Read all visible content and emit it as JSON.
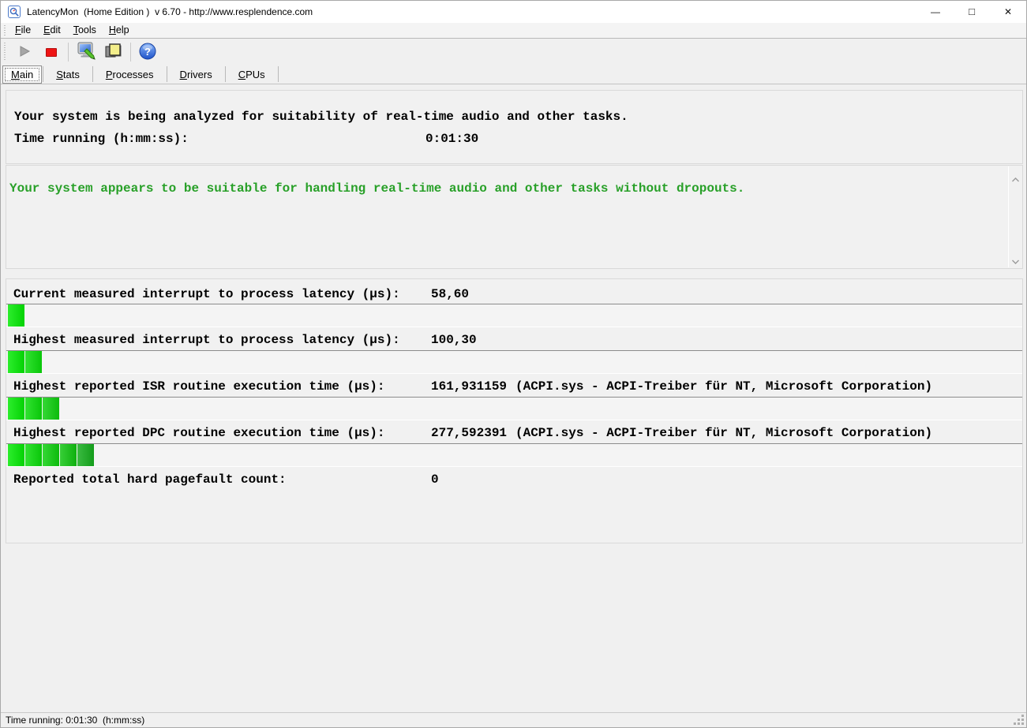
{
  "window": {
    "title": "LatencyMon  (Home Edition )  v 6.70 - http://www.resplendence.com",
    "controls": {
      "minimize": "—",
      "maximize": "□",
      "close": "✕"
    }
  },
  "menu": {
    "items": [
      {
        "label": "File"
      },
      {
        "label": "Edit"
      },
      {
        "label": "Tools"
      },
      {
        "label": "Help"
      }
    ]
  },
  "toolbar": {
    "buttons": [
      {
        "name": "start",
        "icon": "play-icon",
        "enabled": false
      },
      {
        "name": "stop",
        "icon": "stop-icon",
        "enabled": true
      },
      {
        "name": "options",
        "icon": "monitor-tool-icon",
        "enabled": true
      },
      {
        "name": "copy-report",
        "icon": "copy-icon",
        "enabled": true
      },
      {
        "name": "help",
        "icon": "help-icon",
        "enabled": true
      }
    ]
  },
  "tabs": {
    "active": "Main",
    "items": [
      {
        "label": "Main"
      },
      {
        "label": "Stats"
      },
      {
        "label": "Processes"
      },
      {
        "label": "Drivers"
      },
      {
        "label": "CPUs"
      }
    ]
  },
  "analysis": {
    "line1": "Your system is being analyzed for suitability of real-time audio and other tasks.",
    "time_label": "Time running (h:mm:ss):",
    "time_value": "0:01:30"
  },
  "verdict": {
    "message": "Your system appears to be suitable for handling real-time audio and other tasks without dropouts.",
    "color": "#28a028"
  },
  "measurements": {
    "segment_colors": [
      "#04ea04",
      "#0add0a",
      "#0ed00e",
      "#10c510",
      "#15ae1d"
    ],
    "rows": [
      {
        "label": "Current measured interrupt to process latency (µs):",
        "value": "58,60",
        "extra": "",
        "segments": 1
      },
      {
        "label": "Highest measured interrupt to process latency (µs):",
        "value": "100,30",
        "extra": "",
        "segments": 2
      },
      {
        "label": "Highest reported ISR routine execution time (µs):",
        "value": "161,931159",
        "extra": "(ACPI.sys - ACPI-Treiber für NT, Microsoft Corporation)",
        "segments": 3
      },
      {
        "label": "Highest reported DPC routine execution time (µs):",
        "value": "277,592391",
        "extra": "(ACPI.sys - ACPI-Treiber für NT, Microsoft Corporation)",
        "segments": 5
      },
      {
        "label": "Reported total hard pagefault count:",
        "value": "0",
        "extra": "",
        "segments": 0
      }
    ]
  },
  "status_bar": {
    "text": "Time running: 0:01:30  (h:mm:ss)"
  }
}
